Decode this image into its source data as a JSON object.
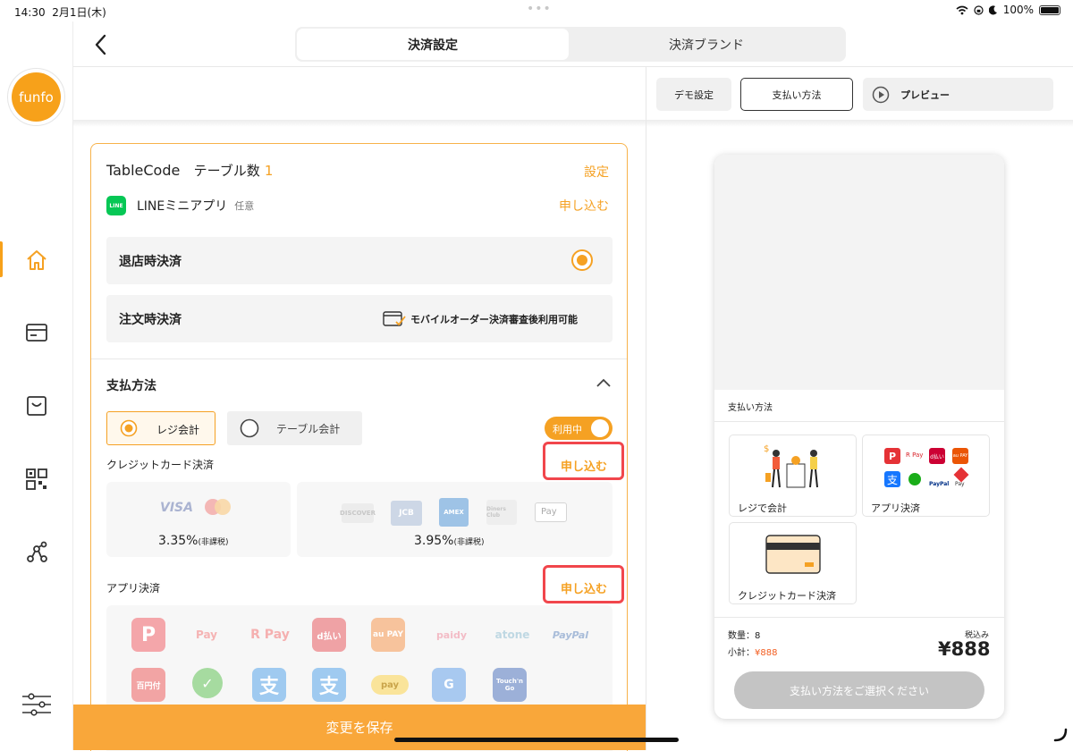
{
  "status_bar": {
    "time": "14:30",
    "date": "2月1日(木)",
    "battery": "100%"
  },
  "brand": {
    "logo_text": "funfo",
    "accent": "#f5a123",
    "highlight": "#f1464c"
  },
  "header": {
    "tabs": [
      "決済設定",
      "決済ブランド"
    ]
  },
  "preview_toolbar": {
    "demo": "デモ設定",
    "payment": "支払い方法",
    "preview": "プレビュー"
  },
  "card": {
    "title": "TableCode",
    "table_count_label": "テーブル数",
    "table_count": "1",
    "settings": "設定",
    "line_app": "LINEミニアプリ",
    "optional": "任意",
    "apply": "申し込む",
    "checkout_on_leave": "退店時決済",
    "checkout_on_order": "注文時決済",
    "mobile_order_note": "モバイルオーダー決済審査後利用可能",
    "payment_methods": "支払方法",
    "register_payment": "レジ会計",
    "table_payment": "テーブル会計",
    "in_use": "利用中",
    "credit_section": "クレジットカード決済",
    "credit_apply": "申し込む",
    "fee1": "3.35%",
    "fee1_note": "(非課税)",
    "fee2": "3.95%",
    "fee2_note": "(非課税)",
    "card_brands_left": [
      "VISA"
    ],
    "card_brands_right": [
      "DISCOVER",
      "JCB",
      "AMEX",
      "Diners Club",
      "Pay"
    ],
    "app_section": "アプリ決済",
    "app_apply": "申し込む",
    "app_logos_row1": [
      "P",
      "Pay",
      "R Pay",
      "d払い",
      "au PAY",
      "paidy",
      "atone",
      "PayPal"
    ],
    "app_logos_row2": [
      "百円付",
      "✓",
      "支",
      "支",
      "pay",
      "G",
      "Touch'n Go"
    ],
    "save": "変更を保存"
  },
  "preview": {
    "payment_method_title": "支払い方法",
    "register_option": "レジで会計",
    "app_option": "アプリ決済",
    "credit_option": "クレジットカード決済",
    "quantity": "数量：8",
    "subtotal_label": "小計：",
    "subtotal_value": "¥888",
    "tax_included": "税込み",
    "total": "¥888",
    "select_button": "支払い方法をご選択ください",
    "mini_logos": [
      "R Pay",
      "d払い",
      "au PAY",
      "PayPal",
      "Pay"
    ]
  }
}
